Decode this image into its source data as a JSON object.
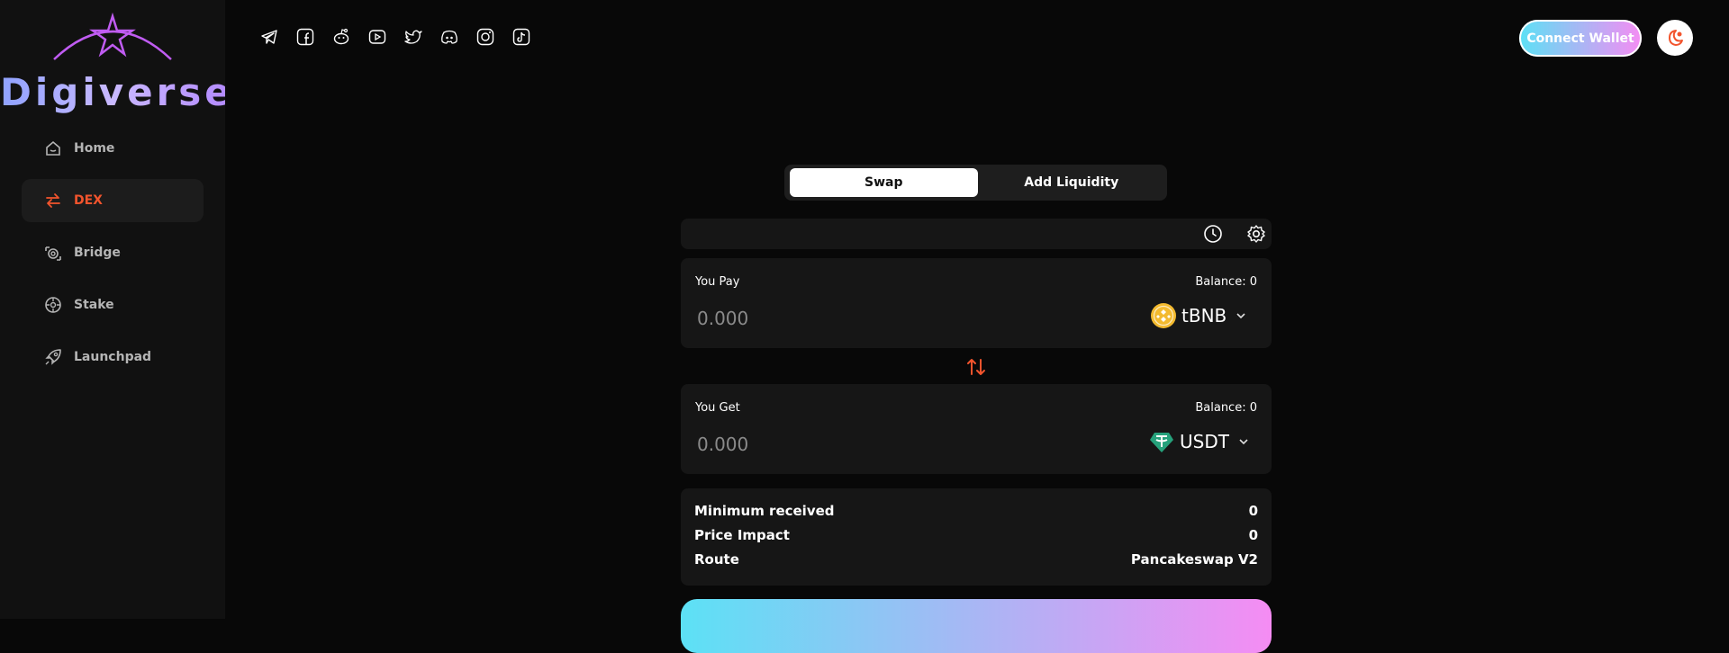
{
  "brand": {
    "name": "Digiverse"
  },
  "sidebar": {
    "items": [
      {
        "label": "Home",
        "icon": "home-icon"
      },
      {
        "label": "DEX",
        "icon": "swap-arrows-icon",
        "active": true
      },
      {
        "label": "Bridge",
        "icon": "bridge-icon"
      },
      {
        "label": "Stake",
        "icon": "stake-icon"
      },
      {
        "label": "Launchpad",
        "icon": "rocket-icon"
      }
    ]
  },
  "header": {
    "socials": [
      "telegram-icon",
      "facebook-icon",
      "reddit-icon",
      "youtube-icon",
      "twitter-icon",
      "discord-icon",
      "instagram-icon",
      "tiktok-icon"
    ],
    "connect_label": "Connect Wallet",
    "theme_icon": "moon-sun-icon"
  },
  "tabs": [
    {
      "label": "Swap",
      "active": true
    },
    {
      "label": "Add Liquidity",
      "active": false
    }
  ],
  "pay": {
    "label": "You Pay",
    "balance": "Balance: 0",
    "placeholder": "0.000",
    "token": "tBNB"
  },
  "get": {
    "label": "You Get",
    "balance": "Balance: 0",
    "placeholder": "0.000",
    "token": "USDT"
  },
  "details": {
    "min_label": "Minimum received",
    "min_value": "0",
    "impact_label": "Price Impact",
    "impact_value": "0",
    "route_label": "Route",
    "route_value": "Pancakeswap V2"
  },
  "colors": {
    "accent": "#f2542d",
    "gradient_start": "#5ce1f5",
    "gradient_end": "#f58cf3",
    "bnb": "#f3ba2f",
    "usdt": "#26a17b"
  }
}
